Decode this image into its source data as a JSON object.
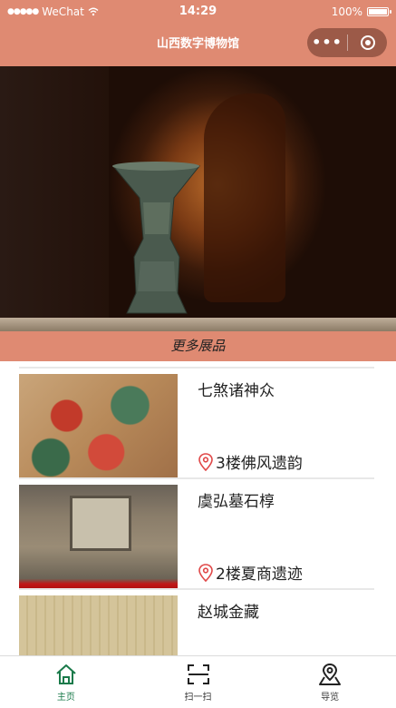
{
  "status": {
    "carrier": "WeChat",
    "time": "14:29",
    "battery": "100%"
  },
  "nav": {
    "title": "山西数字博物馆",
    "menu_glyph": "•••"
  },
  "section": {
    "title": "更多展品"
  },
  "exhibits": [
    {
      "title": "七煞诸神众",
      "location": "3楼佛风遗韵"
    },
    {
      "title": "虞弘墓石椁",
      "location": "2楼夏商遗迹"
    },
    {
      "title": "赵城金藏",
      "location": ""
    }
  ],
  "tabs": [
    {
      "label": "主页",
      "icon": "home-icon",
      "active": true
    },
    {
      "label": "扫一扫",
      "icon": "scan-icon",
      "active": false
    },
    {
      "label": "导览",
      "icon": "map-pin-icon",
      "active": false
    }
  ],
  "colors": {
    "accent": "#df8a72",
    "active_tab": "#1a7a4a",
    "location_icon": "#e04848"
  }
}
